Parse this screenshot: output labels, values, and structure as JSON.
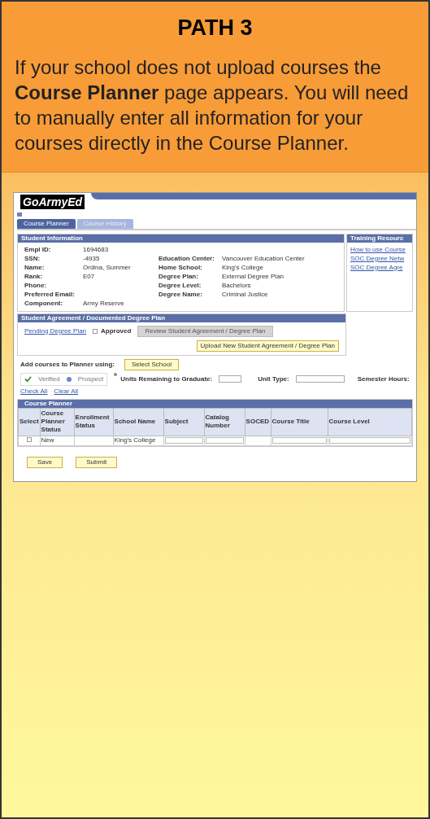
{
  "slide": {
    "title": "PATH 3",
    "text": "If your school does not upload courses the **Course Planner** page appears. You will need to manually enter all information for your courses directly in the Course Planner."
  },
  "screenshot": {
    "logo": "GoArmyEd",
    "tabs": [
      {
        "label": "Course Planner",
        "selected": true
      },
      {
        "label": "Course History",
        "selected": false
      }
    ],
    "student_information": {
      "title": "Student Information",
      "left_fields": [
        {
          "label": "Empl ID:",
          "value": "1694683"
        },
        {
          "label": "SSN:",
          "value": "-4935"
        },
        {
          "label": "Name:",
          "value": "Ordina, Summer"
        },
        {
          "label": "Rank:",
          "value": "E07"
        },
        {
          "label": "Phone:"
        },
        {
          "label": "Preferred Email:"
        },
        {
          "label": "Component:",
          "value": "Army Reserve"
        }
      ],
      "right_fields": [
        {
          "label": "Education Center:",
          "value": "Vancouver Education Center"
        },
        {
          "label": "Home School:",
          "value": "King's College"
        },
        {
          "label": "Degree Plan:",
          "value": "External Degree Plan"
        },
        {
          "label": "Degree Level:",
          "value": "Bachelors"
        },
        {
          "label": "Degree Name:",
          "value": "Criminal Justice"
        }
      ]
    },
    "training_resources": {
      "title": "Training Resourc",
      "links": [
        "How to use Course",
        "SOC Degree Netw",
        "SOC Degree Agre"
      ]
    },
    "agreement": {
      "title": "Student Agreement / Documented Degree Plan",
      "link": "Pending Degree Plan",
      "approved": {
        "label": "Approved",
        "checked": false
      },
      "review_button": {
        "label": "Review Student Agreement / Degree Plan",
        "disabled": true
      },
      "upload_button": "Upload New Student Agreement / Degree Plan"
    },
    "add_courses": {
      "label": "Add courses to Planner using:",
      "button": "Select School",
      "options": [
        {
          "label": "Verified",
          "kind": "check"
        },
        {
          "label": "Prospect",
          "kind": "dot"
        }
      ],
      "units_label": "Units Remaining to Graduate:",
      "unit_type_label": "Unit Type:",
      "semester_label": "Semester Hours:",
      "check_all": "Check All",
      "clear_all": "Clear All"
    },
    "course_planner": {
      "title": "Course Planner",
      "columns": [
        "Select",
        "Course Planner Status",
        "Enrollment Status",
        "School Name",
        "Subject",
        "Catalog Number",
        "SOCED",
        "Course Title",
        "Course Level"
      ],
      "rows": [
        {
          "checked": false,
          "status": "New",
          "school": "King's College"
        }
      ]
    },
    "buttons": [
      "Save",
      "Submit"
    ]
  }
}
